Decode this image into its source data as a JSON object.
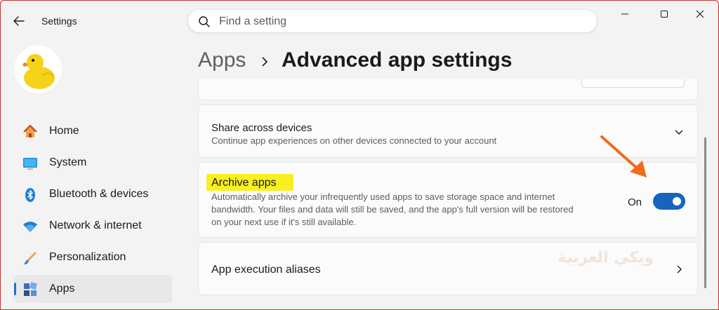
{
  "window": {
    "title": "Settings",
    "minimize_icon": "minimize-icon",
    "maximize_icon": "maximize-icon",
    "close_icon": "close-icon"
  },
  "search": {
    "placeholder": "Find a setting"
  },
  "sidebar": {
    "items": [
      {
        "label": "Home",
        "icon": "home-icon"
      },
      {
        "label": "System",
        "icon": "system-icon"
      },
      {
        "label": "Bluetooth & devices",
        "icon": "bluetooth-icon"
      },
      {
        "label": "Network & internet",
        "icon": "network-icon"
      },
      {
        "label": "Personalization",
        "icon": "brush-icon"
      },
      {
        "label": "Apps",
        "icon": "apps-icon",
        "active": true
      }
    ]
  },
  "breadcrumb": {
    "parent": "Apps",
    "current": "Advanced app settings"
  },
  "cards": {
    "share": {
      "title": "Share across devices",
      "description": "Continue app experiences on other devices connected to your account"
    },
    "archive": {
      "title": "Archive apps",
      "description_line1": "Automatically archive your infrequently used apps to save storage space and internet",
      "description_line2": "bandwidth. Your files and data will still be saved, and the app's full version will be restored",
      "description_line3": "on your next use if it's still available.",
      "toggle_state": "On",
      "toggle_on": true
    },
    "aliases": {
      "title": "App execution aliases"
    }
  },
  "watermark": "ويكي العربية",
  "colors": {
    "accent": "#1565c0",
    "highlight": "#f8ef22",
    "annotation_arrow": "#f26a1b"
  }
}
